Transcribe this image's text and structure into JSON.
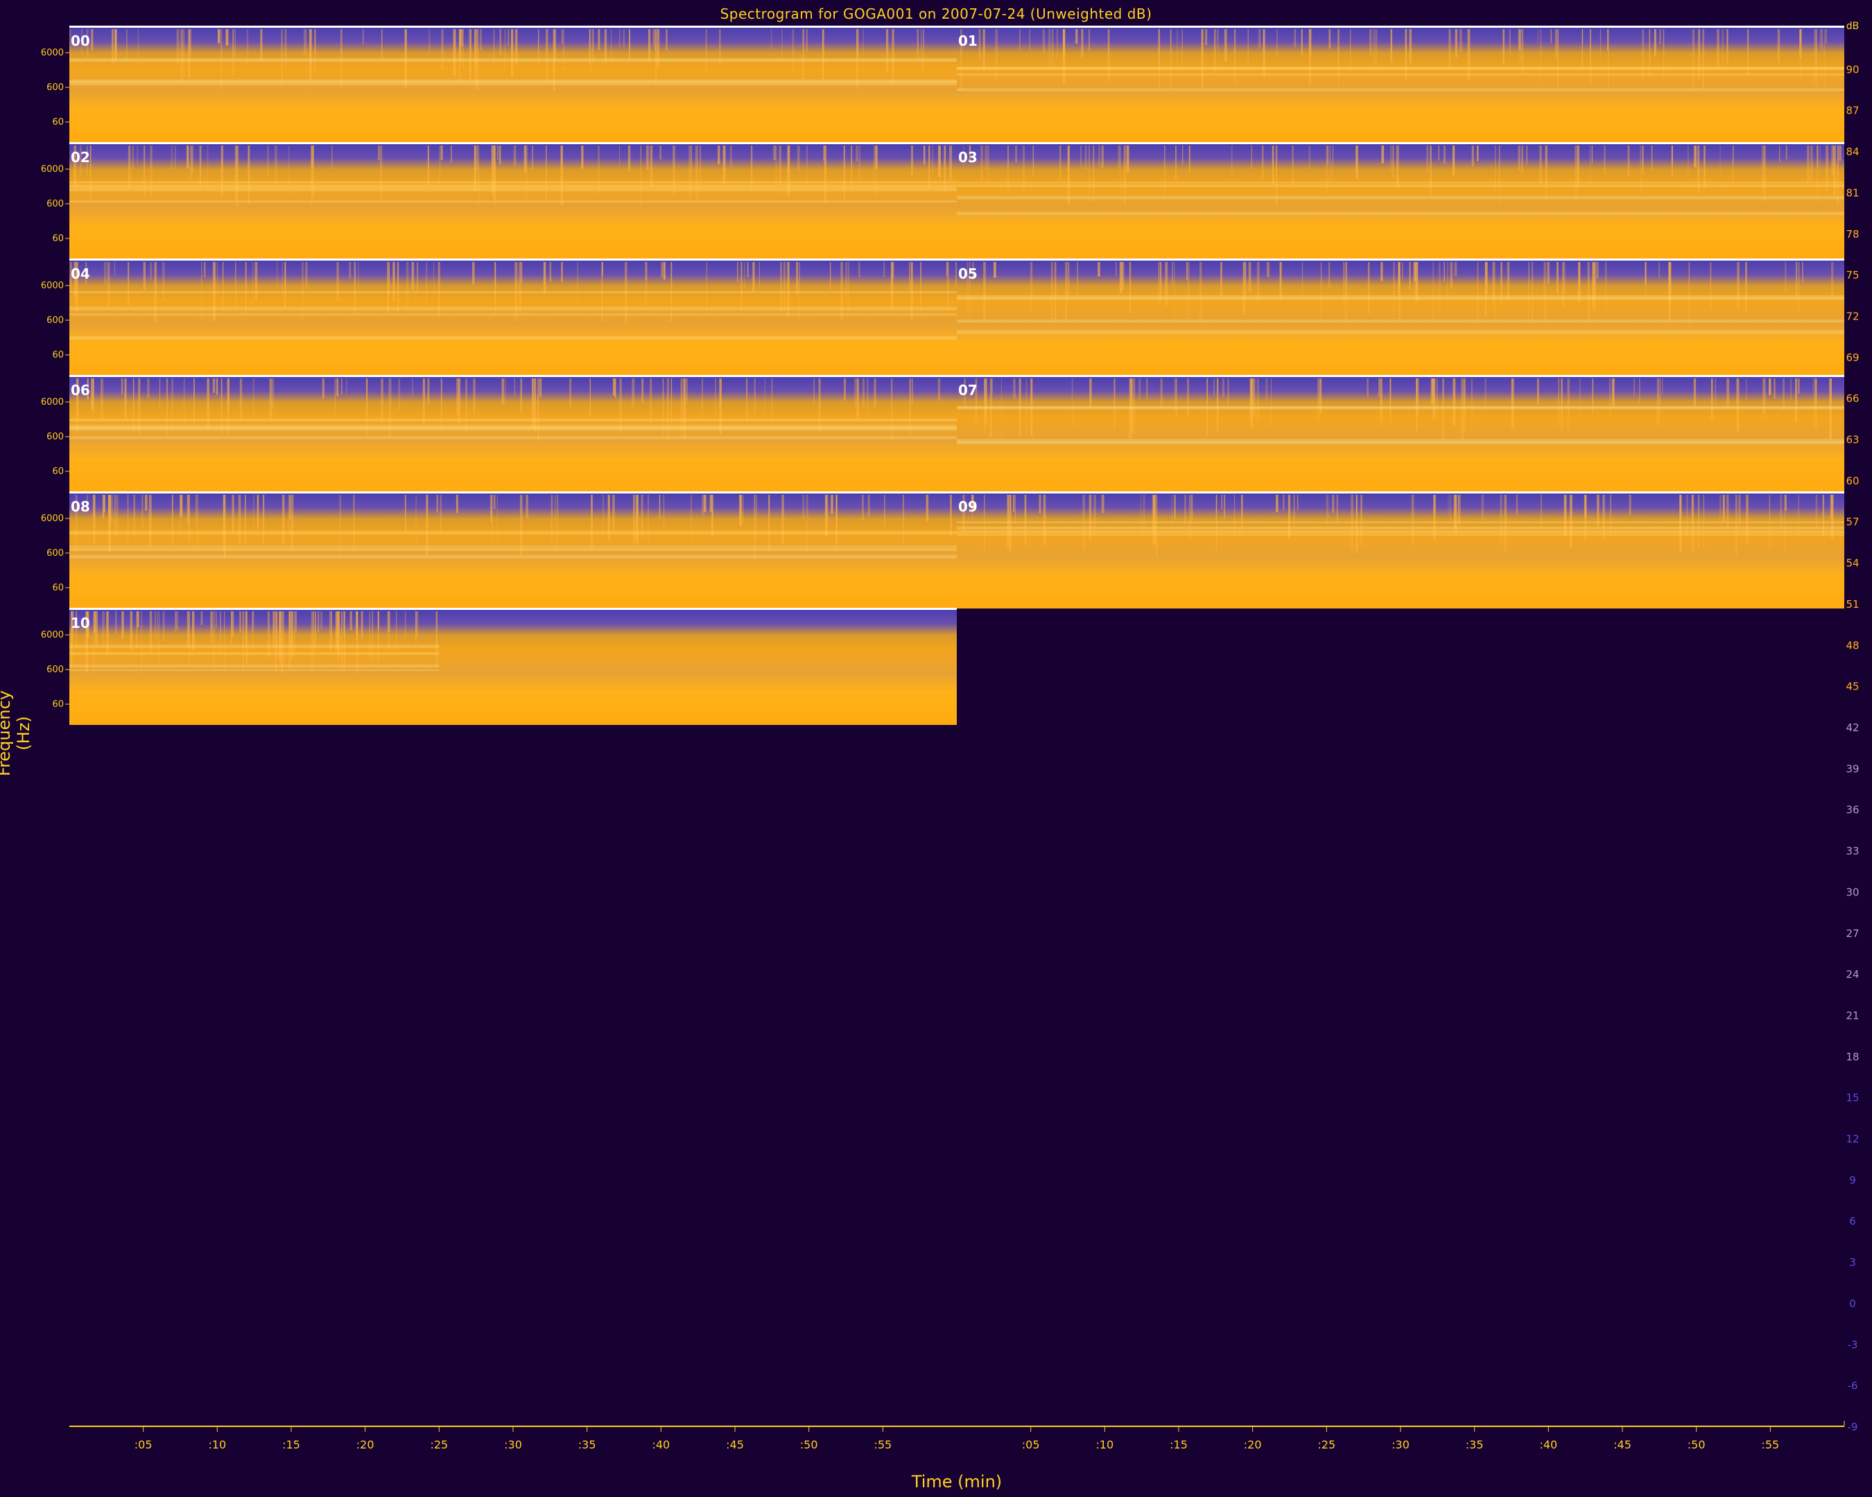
{
  "chart_data": {
    "type": "heatmap",
    "title": "Spectrogram for GOGA001 on 2007-07-24 (Unweighted dB)",
    "xlabel": "Time (min)",
    "ylabel": "Frequency (Hz)",
    "panels": [
      {
        "label": "00",
        "minutes": 60
      },
      {
        "label": "01",
        "minutes": 60
      },
      {
        "label": "02",
        "minutes": 60
      },
      {
        "label": "03",
        "minutes": 60
      },
      {
        "label": "04",
        "minutes": 60
      },
      {
        "label": "05",
        "minutes": 60
      },
      {
        "label": "06",
        "minutes": 60
      },
      {
        "label": "07",
        "minutes": 60
      },
      {
        "label": "08",
        "minutes": 60
      },
      {
        "label": "09",
        "minutes": 60
      },
      {
        "label": "10",
        "minutes": 25
      }
    ],
    "freq_ticks": [
      "6000",
      "600",
      "60"
    ],
    "x_ticks": [
      ":05",
      ":10",
      ":15",
      ":20",
      ":25",
      ":30",
      ":35",
      ":40",
      ":45",
      ":50",
      ":55"
    ],
    "colorbar": {
      "unit": "dB",
      "min": -9,
      "max": 93,
      "ticks": [
        "90",
        "87",
        "84",
        "81",
        "78",
        "75",
        "72",
        "69",
        "66",
        "63",
        "60",
        "57",
        "54",
        "51",
        "48",
        "45",
        "42",
        "39",
        "36",
        "33",
        "30",
        "27",
        "24",
        "21",
        "18",
        "15",
        "12",
        "9",
        "6",
        "3",
        "0",
        "-3",
        "-6",
        "-9"
      ]
    },
    "colors": {
      "background": "#170032",
      "low": "#4b3fae",
      "high": "#ffab10",
      "axis": "#ffd21e",
      "panel_label": "#ffffff"
    }
  }
}
